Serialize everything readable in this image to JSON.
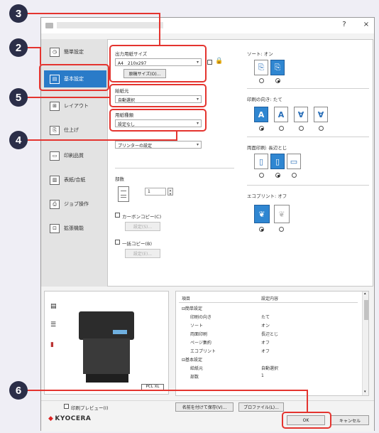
{
  "window": {
    "help_label": "?",
    "close_label": "×"
  },
  "sidebar": {
    "items": [
      {
        "label": "簡単設定",
        "icon": "clock-icon",
        "glyph": "◷"
      },
      {
        "label": "基本設定",
        "icon": "document-icon",
        "glyph": "▤"
      },
      {
        "label": "レイアウト",
        "icon": "layout-icon",
        "glyph": "⊞"
      },
      {
        "label": "仕上げ",
        "icon": "finishing-icon",
        "glyph": "⎘"
      },
      {
        "label": "印刷品質",
        "icon": "quality-icon",
        "glyph": "▭"
      },
      {
        "label": "表紙/合紙",
        "icon": "cover-icon",
        "glyph": "▥"
      },
      {
        "label": "ジョブ操作",
        "icon": "job-icon",
        "glyph": "⎙"
      },
      {
        "label": "拡張機能",
        "icon": "extension-icon",
        "glyph": "⊡"
      }
    ],
    "active_index": 1
  },
  "basic": {
    "paper_size_label": "出力用紙サイズ",
    "paper_size_value": "A4　210x297",
    "original_size_button": "原稿サイズ(O)...",
    "paper_source_label": "給紙元",
    "paper_source_value": "自動選択",
    "media_type_label": "用紙種類",
    "media_type_value": "設定なし",
    "print_mode_value": "プリンターの設定",
    "copies_label": "部数",
    "copies_value": "1",
    "carbon_copy_label": "カーボンコピー(C)",
    "carbon_copy_button": "設定(S)...",
    "blank_page_label": "一括コピー(B)",
    "blank_page_button": "設定(E)..."
  },
  "right": {
    "sort_label": "ソート: オン",
    "orientation_label": "印刷の向き: たて",
    "duplex_label": "両面印刷: 長辺とじ",
    "ecoprint_label": "エコプリント: オフ"
  },
  "summary": {
    "header_item": "項目",
    "header_value": "設定内容",
    "rows": [
      {
        "item": "⊟簡単設定",
        "value": ""
      },
      {
        "item": "印刷の向き",
        "value": "たて"
      },
      {
        "item": "ソート",
        "value": "オン"
      },
      {
        "item": "両面印刷",
        "value": "長辺とじ"
      },
      {
        "item": "ページ集約",
        "value": "オフ"
      },
      {
        "item": "エコプリント",
        "value": "オフ"
      },
      {
        "item": "⊟基本設定",
        "value": ""
      },
      {
        "item": "給紙元",
        "value": "自動選択"
      },
      {
        "item": "部数",
        "value": "1"
      }
    ]
  },
  "preview": {
    "printer_label": "PCL XL"
  },
  "footer": {
    "print_preview_label": "印刷プレビュー(I)",
    "save_profile_button": "名前を付けて保存(V)...",
    "profile_button": "プロファイル(L)...",
    "ok_button": "OK",
    "cancel_button": "キャンセル",
    "logo_text": "KYOCERA",
    "logo_mark": "◆"
  },
  "badges": [
    "3",
    "2",
    "5",
    "4",
    "6"
  ],
  "colors": {
    "highlight": "#e4342f",
    "badge": "#2b2e48",
    "accent": "#2a7bc8"
  }
}
